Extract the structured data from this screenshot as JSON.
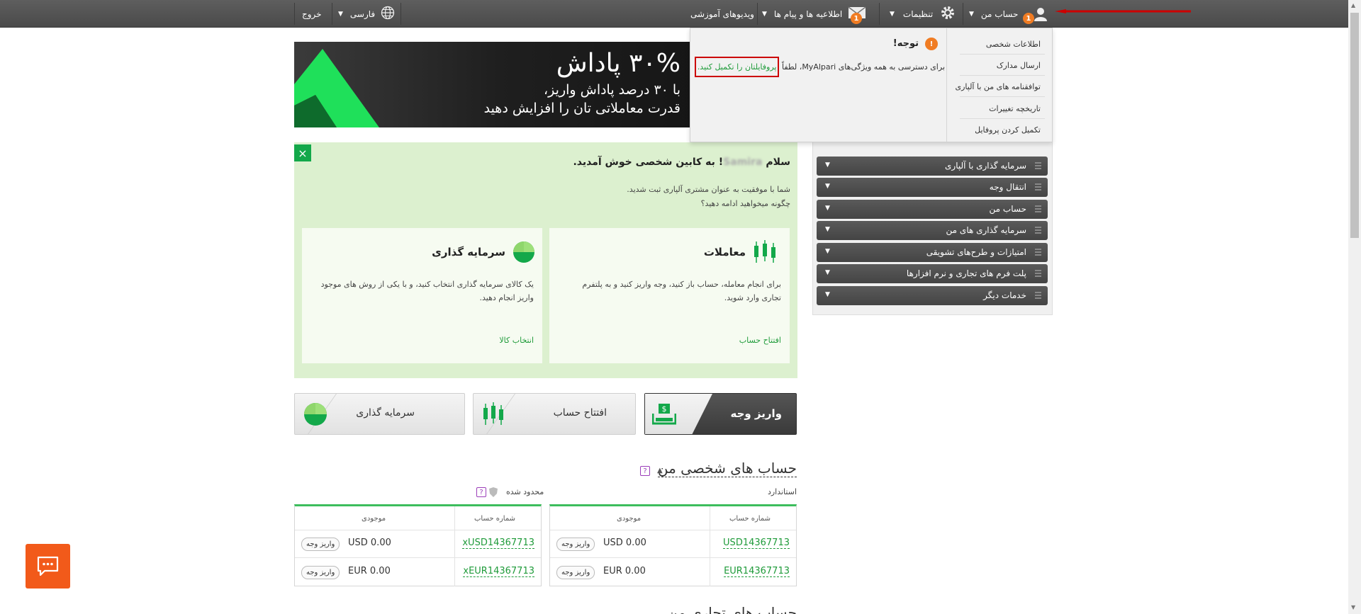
{
  "topbar": {
    "account_label": "حساب من",
    "account_badge": "1",
    "settings_label": "تنظیمات",
    "messages_label": "اطلاعیه ها و پیام ها",
    "messages_badge": "1",
    "videos_label": "ویدیوهای آموزشی",
    "language_label": "فارسی",
    "logout_label": "خروج"
  },
  "dropdown": {
    "menu_items": [
      "اطلاعات شخصی",
      "ارسال مدارک",
      "توافقنامه های من با آلپاری",
      "تاریخچه تغییرات",
      "تکمیل کردن پروفایل"
    ],
    "notice_title": "توجه!",
    "notice_text": "برای دسترسی به همه ویژگی‌های MyAlpari، لطفاً",
    "notice_link": "پروفایلتان را تکمیل کنید."
  },
  "banner": {
    "title": "۳۰% پاداش",
    "line1": "با ۳۰ درصد پاداش واریز،",
    "line2": "قدرت معاملاتی تان را افزایش دهید",
    "big_digit": "3"
  },
  "welcome": {
    "close_symbol": "×",
    "greeting_prefix": "سلام",
    "greeting_name": "Samira",
    "greeting_suffix": "! به کابین شخصی خوش آمدید.",
    "line1": "شما با موفقیت به عنوان مشتری آلپاری ثبت شدید.",
    "line2": "چگونه میخواهید ادامه دهید؟",
    "cards": [
      {
        "title": "معاملات",
        "text": "برای انجام معامله، حساب باز کنید، وجه واریز کنید و به پلتفرم تجاری وارد شوید.",
        "link": "افتتاح حساب"
      },
      {
        "title": "سرمایه گذاری",
        "text": "یک کالای سرمایه گذاری انتخاب کنید، و با یکی از روش های موجود واریز انجام دهید.",
        "link": "انتخاب کالا"
      }
    ]
  },
  "actions": {
    "deposit": "واریز وجه",
    "open_account": "افتتاح حساب",
    "invest": "سرمایه گذاری"
  },
  "sidebar": {
    "items": [
      "سرمایه گذاری با آلپاری",
      "انتقال وجه",
      "حساب من",
      "سرمایه گذاری های من",
      "امتیازات و طرح‌های تشویقی",
      "پلت فرم های تجاری و نرم افزارها",
      "خدمات دیگر"
    ]
  },
  "accounts": {
    "section_title": "حساب های شخصی من",
    "help_symbol": "?",
    "standard_label": "استاندارد",
    "limited_label": "محدود شده",
    "col_account": "شماره حساب",
    "col_balance": "موجودی",
    "deposit_btn": "واریز وجه",
    "standard_rows": [
      {
        "account": "USD14367713",
        "balance": "USD 0.00"
      },
      {
        "account": "EUR14367713",
        "balance": "EUR 0.00"
      }
    ],
    "limited_rows": [
      {
        "account": "xUSD14367713",
        "balance": "USD 0.00"
      },
      {
        "account": "xEUR14367713",
        "balance": "EUR 0.00"
      }
    ],
    "next_section_partial": "حساب های تجاری من"
  },
  "colors": {
    "accent_green": "#13a84a",
    "badge_orange": "#f07c23",
    "chat_orange": "#f25a1a",
    "highlight_red": "#cc0000"
  }
}
